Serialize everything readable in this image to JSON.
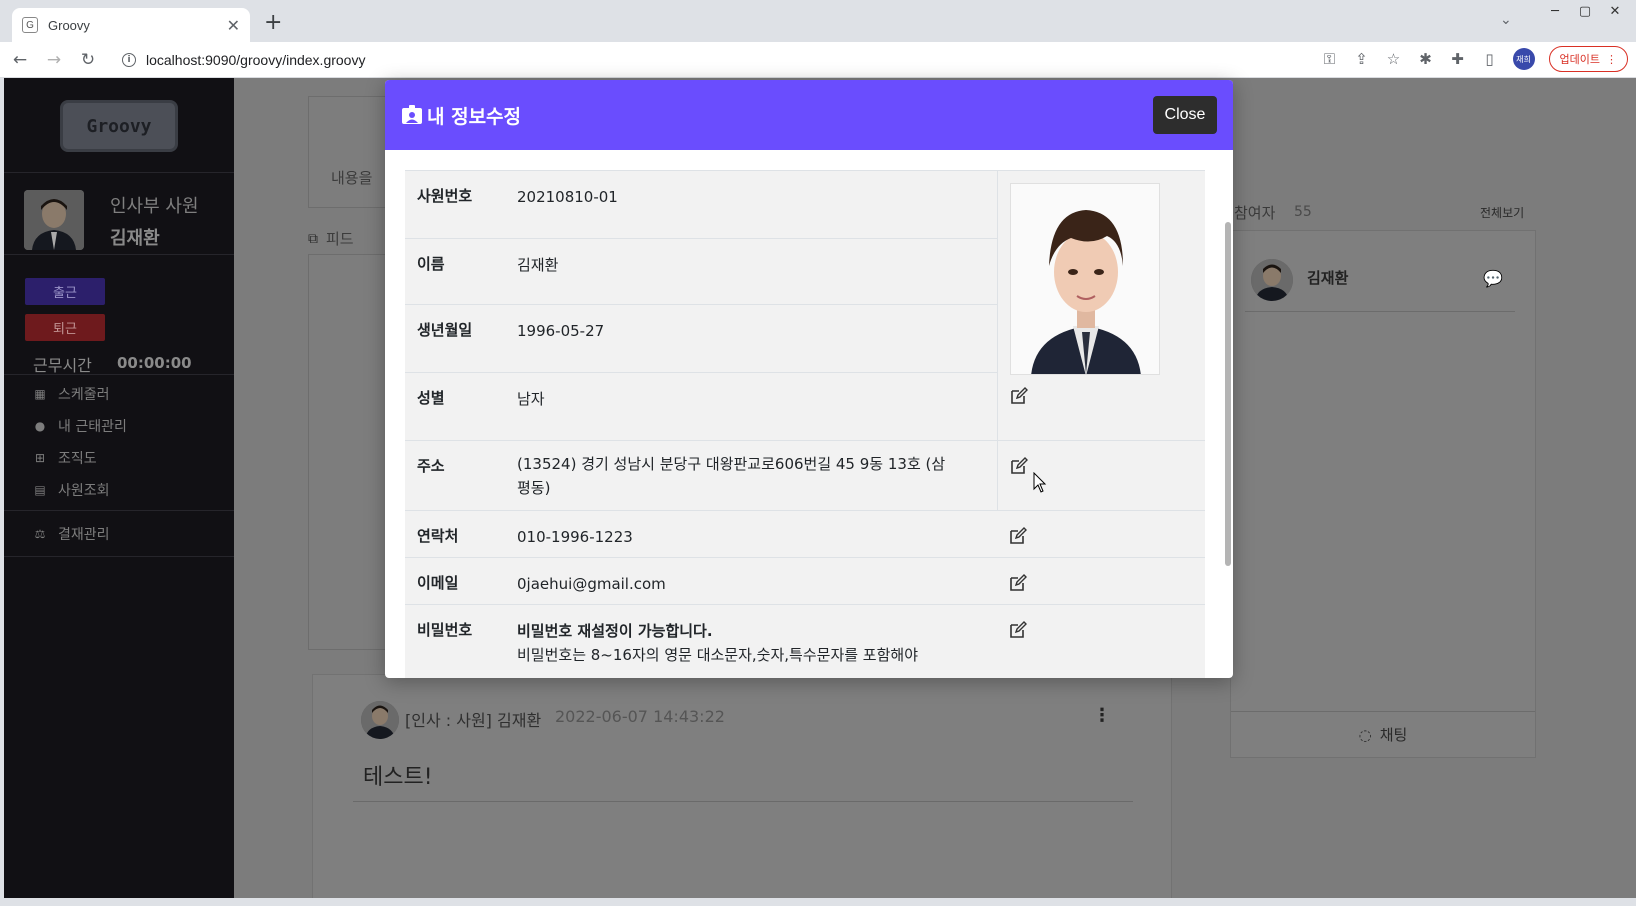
{
  "browser": {
    "tab_title": "Groovy",
    "favicon_letter": "G",
    "new_tab": "+",
    "url": "localhost:9090/groovy/index.groovy",
    "profile_label": "재희",
    "update_label": "업데이트"
  },
  "sidebar": {
    "logo_text": "Groovy",
    "role": "인사부 사원",
    "name": "김재환",
    "clock_in": "출근",
    "clock_out": "퇴근",
    "worktime_label": "근무시간",
    "worktime_value": "00:00:00",
    "menu": [
      {
        "label": "스케줄러",
        "icon": "calendar-icon"
      },
      {
        "label": "내 근태관리",
        "icon": "user-clock-icon"
      },
      {
        "label": "조직도",
        "icon": "sitemap-icon"
      },
      {
        "label": "사원조회",
        "icon": "id-card-icon"
      },
      {
        "label": "결재관리",
        "icon": "scale-icon"
      }
    ]
  },
  "background": {
    "content_placeholder": "내용을",
    "feed_label": "피드",
    "post": {
      "author": "[인사 : 사원] 김재환",
      "date": "2022-06-07 14:43:22",
      "body": "테스트!"
    },
    "participants": {
      "title": "참여자",
      "count": "55",
      "view_all": "전체보기",
      "member_name": "김재환",
      "chat_label": "채팅"
    }
  },
  "modal": {
    "title": "내 정보수정",
    "close_label": "Close",
    "fields": [
      {
        "label": "사원번호",
        "value": "20210810-01"
      },
      {
        "label": "이름",
        "value": "김재환"
      },
      {
        "label": "생년월일",
        "value": "1996-05-27"
      },
      {
        "label": "성별",
        "value": "남자"
      },
      {
        "label": "주소",
        "value": "(13524) 경기 성남시 분당구 대왕판교로606번길 45 9동 13호 (삼평동)"
      },
      {
        "label": "연락처",
        "value": "010-1996-1223"
      },
      {
        "label": "이메일",
        "value": "0jaehui@gmail.com"
      },
      {
        "label": "비밀번호",
        "value": "비밀번호 재설정이 가능합니다.",
        "note": "비밀번호는 8~16자의 영문 대소문자,숫자,특수문자를 포함해야"
      }
    ]
  },
  "colors": {
    "modal_header": "#6a4dfe",
    "close_button": "#2d2d2d",
    "sidebar_bg": "#111014"
  }
}
